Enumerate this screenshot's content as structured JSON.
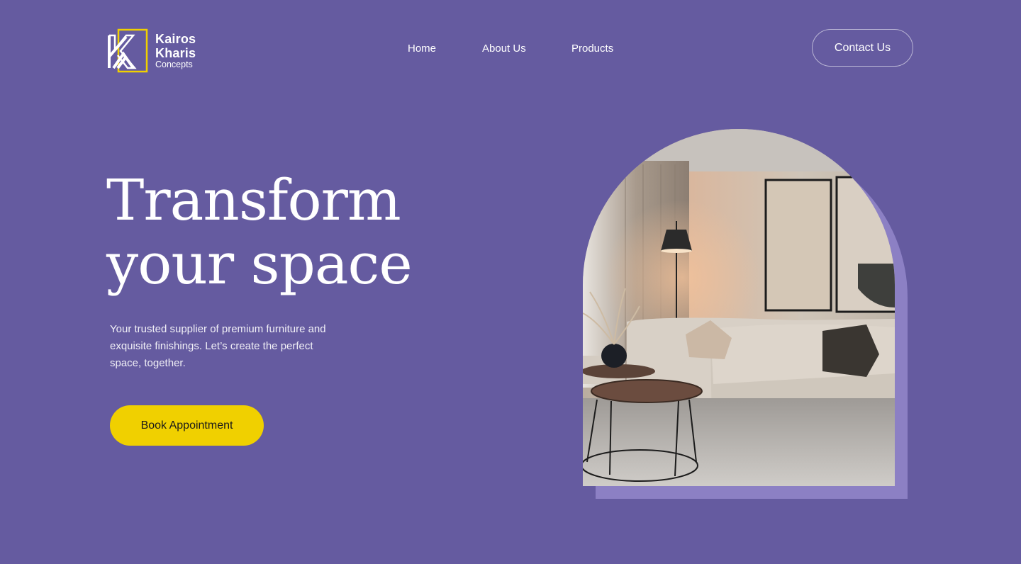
{
  "brand": {
    "line1": "Kairos",
    "line2": "Kharis",
    "line3": "Concepts",
    "accent_color": "#f0d000"
  },
  "nav": {
    "home": "Home",
    "about": "About Us",
    "products": "Products"
  },
  "header": {
    "contact_label": "Contact Us"
  },
  "hero": {
    "title_line1": "Transform",
    "title_line2": "your space",
    "subtitle": "Your trusted supplier of premium furniture and exquisite finishings. Let’s create the perfect space, together.",
    "cta_label": "Book Appointment"
  },
  "colors": {
    "background": "#655ba0",
    "cta": "#f0d000",
    "arch_shadow": "#8c80c4"
  },
  "image": {
    "icon": "living-room-photo"
  }
}
